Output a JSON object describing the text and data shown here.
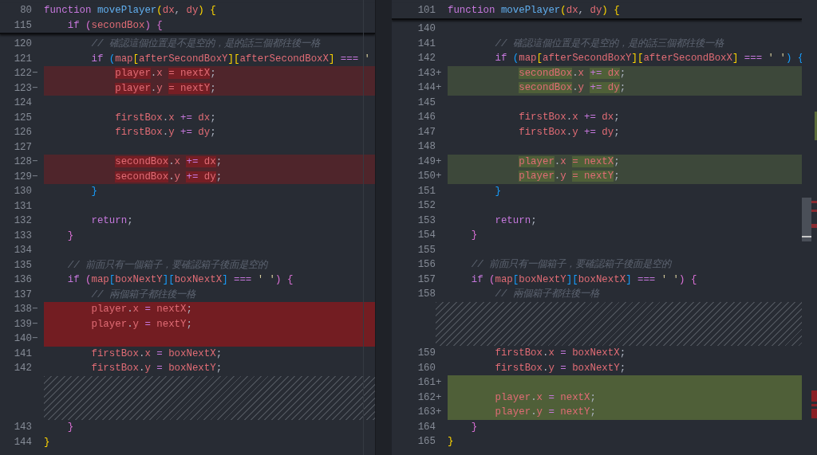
{
  "panes": [
    {
      "sticky": [
        {
          "num": "80",
          "tokens": [
            {
              "text": "function ",
              "kind": "kw"
            },
            {
              "text": "movePlayer",
              "kind": "fn"
            },
            {
              "text": "(",
              "kind": "b1"
            },
            {
              "text": "dx",
              "kind": "var"
            },
            {
              "text": ", ",
              "kind": "punc"
            },
            {
              "text": "dy",
              "kind": "var"
            },
            {
              "text": ")",
              "kind": "b1"
            },
            {
              "text": " {",
              "kind": "b1"
            }
          ]
        },
        {
          "num": "115",
          "tokens": [
            {
              "text": "    if ",
              "kind": "kw"
            },
            {
              "text": "(",
              "kind": "b2"
            },
            {
              "text": "secondBox",
              "kind": "var"
            },
            {
              "text": ")",
              "kind": "b2"
            },
            {
              "text": " {",
              "kind": "b2"
            }
          ]
        }
      ],
      "lines": [
        {
          "kind": "context",
          "num": "120",
          "tokens": [
            {
              "text": "        // 確認這個位置是不是空的，是的話三個都往後一格",
              "kind": "comment"
            }
          ]
        },
        {
          "kind": "context",
          "num": "121",
          "tokens": [
            {
              "text": "        if ",
              "kind": "kw"
            },
            {
              "text": "(",
              "kind": "b3"
            },
            {
              "text": "map",
              "kind": "var"
            },
            {
              "text": "[",
              "kind": "b1"
            },
            {
              "text": "afterSecondBoxY",
              "kind": "var"
            },
            {
              "text": "]",
              "kind": "b1"
            },
            {
              "text": "[",
              "kind": "b1"
            },
            {
              "text": "afterSecondBoxX",
              "kind": "var"
            },
            {
              "text": "]",
              "kind": "b1"
            },
            {
              "text": " === ",
              "kind": "kw"
            },
            {
              "text": "'",
              "kind": "str"
            }
          ]
        },
        {
          "kind": "removed",
          "num": "122",
          "marker": "−",
          "tokens": [
            {
              "text": "            player",
              "kind": "var",
              "hl": true
            },
            {
              "text": ".",
              "kind": "punc",
              "hl": false
            },
            {
              "text": "x ",
              "kind": "var",
              "hl": false
            },
            {
              "text": "= nextX",
              "kind": "var",
              "hl": true
            },
            {
              "text": ";",
              "kind": "punc",
              "hl": false
            }
          ]
        },
        {
          "kind": "removed",
          "num": "123",
          "marker": "−",
          "tokens": [
            {
              "text": "            player",
              "kind": "var",
              "hl": true
            },
            {
              "text": ".",
              "kind": "punc",
              "hl": false
            },
            {
              "text": "y ",
              "kind": "var",
              "hl": false
            },
            {
              "text": "= nextY",
              "kind": "var",
              "hl": true
            },
            {
              "text": ";",
              "kind": "punc",
              "hl": false
            }
          ]
        },
        {
          "kind": "context",
          "num": "124"
        },
        {
          "kind": "context",
          "num": "125",
          "tokens": [
            {
              "text": "            firstBox",
              "kind": "var"
            },
            {
              "text": ".",
              "kind": "punc"
            },
            {
              "text": "x ",
              "kind": "var"
            },
            {
              "text": "+= ",
              "kind": "kw"
            },
            {
              "text": "dx",
              "kind": "var"
            },
            {
              "text": ";",
              "kind": "punc"
            }
          ]
        },
        {
          "kind": "context",
          "num": "126",
          "tokens": [
            {
              "text": "            firstBox",
              "kind": "var"
            },
            {
              "text": ".",
              "kind": "punc"
            },
            {
              "text": "y ",
              "kind": "var"
            },
            {
              "text": "+= ",
              "kind": "kw"
            },
            {
              "text": "dy",
              "kind": "var"
            },
            {
              "text": ";",
              "kind": "punc"
            }
          ]
        },
        {
          "kind": "context",
          "num": "127"
        },
        {
          "kind": "removed",
          "num": "128",
          "marker": "−",
          "tokens": [
            {
              "text": "            secondBox",
              "kind": "var",
              "hl": true
            },
            {
              "text": ".",
              "kind": "punc",
              "hl": false
            },
            {
              "text": "x ",
              "kind": "var",
              "hl": false
            },
            {
              "text": "+= ",
              "kind": "kw",
              "hl": true
            },
            {
              "text": "dx",
              "kind": "var",
              "hl": true
            },
            {
              "text": ";",
              "kind": "punc",
              "hl": false
            }
          ]
        },
        {
          "kind": "removed",
          "num": "129",
          "marker": "−",
          "tokens": [
            {
              "text": "            secondBox",
              "kind": "var",
              "hl": true
            },
            {
              "text": ".",
              "kind": "punc",
              "hl": false
            },
            {
              "text": "y ",
              "kind": "var",
              "hl": false
            },
            {
              "text": "+= ",
              "kind": "kw",
              "hl": true
            },
            {
              "text": "dy",
              "kind": "var",
              "hl": true
            },
            {
              "text": ";",
              "kind": "punc",
              "hl": false
            }
          ]
        },
        {
          "kind": "context",
          "num": "130",
          "tokens": [
            {
              "text": "        }",
              "kind": "b3"
            }
          ]
        },
        {
          "kind": "context",
          "num": "131"
        },
        {
          "kind": "context",
          "num": "132",
          "tokens": [
            {
              "text": "        return",
              "kind": "kw"
            },
            {
              "text": ";",
              "kind": "punc"
            }
          ]
        },
        {
          "kind": "context",
          "num": "133",
          "tokens": [
            {
              "text": "    }",
              "kind": "b2"
            }
          ]
        },
        {
          "kind": "context",
          "num": "134"
        },
        {
          "kind": "context",
          "num": "135",
          "tokens": [
            {
              "text": "    // 前面只有一個箱子，要確認箱子後面是空的",
              "kind": "comment"
            }
          ]
        },
        {
          "kind": "context",
          "num": "136",
          "tokens": [
            {
              "text": "    if ",
              "kind": "kw"
            },
            {
              "text": "(",
              "kind": "b2"
            },
            {
              "text": "map",
              "kind": "var"
            },
            {
              "text": "[",
              "kind": "b3"
            },
            {
              "text": "boxNextY",
              "kind": "var"
            },
            {
              "text": "]",
              "kind": "b3"
            },
            {
              "text": "[",
              "kind": "b3"
            },
            {
              "text": "boxNextX",
              "kind": "var"
            },
            {
              "text": "]",
              "kind": "b3"
            },
            {
              "text": " === ",
              "kind": "kw"
            },
            {
              "text": "' '",
              "kind": "str"
            },
            {
              "text": ")",
              "kind": "b2"
            },
            {
              "text": " {",
              "kind": "b2"
            }
          ]
        },
        {
          "kind": "context",
          "num": "137",
          "tokens": [
            {
              "text": "        // 兩個箱子都往後一格",
              "kind": "comment"
            }
          ]
        },
        {
          "kind": "removed-whole",
          "num": "138",
          "marker": "−",
          "tokens": [
            {
              "text": "        player",
              "kind": "var"
            },
            {
              "text": ".",
              "kind": "punc"
            },
            {
              "text": "x ",
              "kind": "var"
            },
            {
              "text": "= ",
              "kind": "kw"
            },
            {
              "text": "nextX",
              "kind": "var"
            },
            {
              "text": ";",
              "kind": "punc"
            }
          ]
        },
        {
          "kind": "removed-whole",
          "num": "139",
          "marker": "−",
          "tokens": [
            {
              "text": "        player",
              "kind": "var"
            },
            {
              "text": ".",
              "kind": "punc"
            },
            {
              "text": "y ",
              "kind": "var"
            },
            {
              "text": "= ",
              "kind": "kw"
            },
            {
              "text": "nextY",
              "kind": "var"
            },
            {
              "text": ";",
              "kind": "punc"
            }
          ]
        },
        {
          "kind": "removed-whole",
          "num": "140",
          "marker": "−"
        },
        {
          "kind": "context",
          "num": "141",
          "tokens": [
            {
              "text": "        firstBox",
              "kind": "var"
            },
            {
              "text": ".",
              "kind": "punc"
            },
            {
              "text": "x ",
              "kind": "var"
            },
            {
              "text": "= ",
              "kind": "kw"
            },
            {
              "text": "boxNextX",
              "kind": "var"
            },
            {
              "text": ";",
              "kind": "punc"
            }
          ]
        },
        {
          "kind": "context",
          "num": "142",
          "tokens": [
            {
              "text": "        firstBox",
              "kind": "var"
            },
            {
              "text": ".",
              "kind": "punc"
            },
            {
              "text": "y ",
              "kind": "var"
            },
            {
              "text": "= ",
              "kind": "kw"
            },
            {
              "text": "boxNextY",
              "kind": "var"
            },
            {
              "text": ";",
              "kind": "punc"
            }
          ]
        },
        {
          "kind": "filler"
        },
        {
          "kind": "context",
          "num": "143",
          "tokens": [
            {
              "text": "    }",
              "kind": "b2"
            }
          ]
        },
        {
          "kind": "context",
          "num": "144",
          "tokens": [
            {
              "text": "}",
              "kind": "b1"
            }
          ]
        }
      ]
    },
    {
      "sticky": [
        {
          "num": "101",
          "tokens": [
            {
              "text": "function ",
              "kind": "kw"
            },
            {
              "text": "movePlayer",
              "kind": "fn"
            },
            {
              "text": "(",
              "kind": "b1"
            },
            {
              "text": "dx",
              "kind": "var"
            },
            {
              "text": ", ",
              "kind": "punc"
            },
            {
              "text": "dy",
              "kind": "var"
            },
            {
              "text": ")",
              "kind": "b1"
            },
            {
              "text": " {",
              "kind": "b1"
            }
          ]
        }
      ],
      "lines": [
        {
          "kind": "context",
          "num": "140"
        },
        {
          "kind": "context",
          "num": "141",
          "tokens": [
            {
              "text": "        // 確認這個位置是不是空的，是的話三個都往後一格",
              "kind": "comment"
            }
          ]
        },
        {
          "kind": "context",
          "num": "142",
          "tokens": [
            {
              "text": "        if ",
              "kind": "kw"
            },
            {
              "text": "(",
              "kind": "b3"
            },
            {
              "text": "map",
              "kind": "var"
            },
            {
              "text": "[",
              "kind": "b1"
            },
            {
              "text": "afterSecondBoxY",
              "kind": "var"
            },
            {
              "text": "]",
              "kind": "b1"
            },
            {
              "text": "[",
              "kind": "b1"
            },
            {
              "text": "afterSecondBoxX",
              "kind": "var"
            },
            {
              "text": "]",
              "kind": "b1"
            },
            {
              "text": " === ",
              "kind": "kw"
            },
            {
              "text": "' '",
              "kind": "str"
            },
            {
              "text": ")",
              "kind": "b3"
            },
            {
              "text": " {",
              "kind": "b3"
            }
          ]
        },
        {
          "kind": "added",
          "num": "143",
          "marker": "+",
          "tokens": [
            {
              "text": "            secondBox",
              "kind": "var",
              "hl": true
            },
            {
              "text": ".",
              "kind": "punc",
              "hl": false
            },
            {
              "text": "x ",
              "kind": "var",
              "hl": false
            },
            {
              "text": "+= ",
              "kind": "kw",
              "hl": true
            },
            {
              "text": "dx",
              "kind": "var",
              "hl": true
            },
            {
              "text": ";",
              "kind": "punc",
              "hl": false
            }
          ]
        },
        {
          "kind": "added",
          "num": "144",
          "marker": "+",
          "tokens": [
            {
              "text": "            secondBox",
              "kind": "var",
              "hl": true
            },
            {
              "text": ".",
              "kind": "punc",
              "hl": false
            },
            {
              "text": "y ",
              "kind": "var",
              "hl": false
            },
            {
              "text": "+= ",
              "kind": "kw",
              "hl": true
            },
            {
              "text": "dy",
              "kind": "var",
              "hl": true
            },
            {
              "text": ";",
              "kind": "punc",
              "hl": false
            }
          ]
        },
        {
          "kind": "context",
          "num": "145"
        },
        {
          "kind": "context",
          "num": "146",
          "tokens": [
            {
              "text": "            firstBox",
              "kind": "var"
            },
            {
              "text": ".",
              "kind": "punc"
            },
            {
              "text": "x ",
              "kind": "var"
            },
            {
              "text": "+= ",
              "kind": "kw"
            },
            {
              "text": "dx",
              "kind": "var"
            },
            {
              "text": ";",
              "kind": "punc"
            }
          ]
        },
        {
          "kind": "context",
          "num": "147",
          "tokens": [
            {
              "text": "            firstBox",
              "kind": "var"
            },
            {
              "text": ".",
              "kind": "punc"
            },
            {
              "text": "y ",
              "kind": "var"
            },
            {
              "text": "+= ",
              "kind": "kw"
            },
            {
              "text": "dy",
              "kind": "var"
            },
            {
              "text": ";",
              "kind": "punc"
            }
          ]
        },
        {
          "kind": "context",
          "num": "148"
        },
        {
          "kind": "added",
          "num": "149",
          "marker": "+",
          "tokens": [
            {
              "text": "            player",
              "kind": "var",
              "hl": true
            },
            {
              "text": ".",
              "kind": "punc",
              "hl": false
            },
            {
              "text": "x ",
              "kind": "var",
              "hl": false
            },
            {
              "text": "= nextX",
              "kind": "var",
              "hl": true
            },
            {
              "text": ";",
              "kind": "punc",
              "hl": false
            }
          ]
        },
        {
          "kind": "added",
          "num": "150",
          "marker": "+",
          "tokens": [
            {
              "text": "            player",
              "kind": "var",
              "hl": true
            },
            {
              "text": ".",
              "kind": "punc",
              "hl": false
            },
            {
              "text": "y ",
              "kind": "var",
              "hl": false
            },
            {
              "text": "= nextY",
              "kind": "var",
              "hl": true
            },
            {
              "text": ";",
              "kind": "punc",
              "hl": false
            }
          ]
        },
        {
          "kind": "context",
          "num": "151",
          "tokens": [
            {
              "text": "        }",
              "kind": "b3"
            }
          ]
        },
        {
          "kind": "context",
          "num": "152"
        },
        {
          "kind": "context",
          "num": "153",
          "tokens": [
            {
              "text": "        return",
              "kind": "kw"
            },
            {
              "text": ";",
              "kind": "punc"
            }
          ]
        },
        {
          "kind": "context",
          "num": "154",
          "tokens": [
            {
              "text": "    }",
              "kind": "b2"
            }
          ]
        },
        {
          "kind": "context",
          "num": "155"
        },
        {
          "kind": "context",
          "num": "156",
          "tokens": [
            {
              "text": "    // 前面只有一個箱子，要確認箱子後面是空的",
              "kind": "comment"
            }
          ]
        },
        {
          "kind": "context",
          "num": "157",
          "tokens": [
            {
              "text": "    if ",
              "kind": "kw"
            },
            {
              "text": "(",
              "kind": "b2"
            },
            {
              "text": "map",
              "kind": "var"
            },
            {
              "text": "[",
              "kind": "b3"
            },
            {
              "text": "boxNextY",
              "kind": "var"
            },
            {
              "text": "]",
              "kind": "b3"
            },
            {
              "text": "[",
              "kind": "b3"
            },
            {
              "text": "boxNextX",
              "kind": "var"
            },
            {
              "text": "]",
              "kind": "b3"
            },
            {
              "text": " === ",
              "kind": "kw"
            },
            {
              "text": "' '",
              "kind": "str"
            },
            {
              "text": ")",
              "kind": "b2"
            },
            {
              "text": " {",
              "kind": "b2"
            }
          ]
        },
        {
          "kind": "context",
          "num": "158",
          "tokens": [
            {
              "text": "        // 兩個箱子都往後一格",
              "kind": "comment"
            }
          ]
        },
        {
          "kind": "filler"
        },
        {
          "kind": "context",
          "num": "159",
          "tokens": [
            {
              "text": "        firstBox",
              "kind": "var"
            },
            {
              "text": ".",
              "kind": "punc"
            },
            {
              "text": "x ",
              "kind": "var"
            },
            {
              "text": "= ",
              "kind": "kw"
            },
            {
              "text": "boxNextX",
              "kind": "var"
            },
            {
              "text": ";",
              "kind": "punc"
            }
          ]
        },
        {
          "kind": "context",
          "num": "160",
          "tokens": [
            {
              "text": "        firstBox",
              "kind": "var"
            },
            {
              "text": ".",
              "kind": "punc"
            },
            {
              "text": "y ",
              "kind": "var"
            },
            {
              "text": "= ",
              "kind": "kw"
            },
            {
              "text": "boxNextY",
              "kind": "var"
            },
            {
              "text": ";",
              "kind": "punc"
            }
          ]
        },
        {
          "kind": "added-whole",
          "num": "161",
          "marker": "+"
        },
        {
          "kind": "added-whole",
          "num": "162",
          "marker": "+",
          "tokens": [
            {
              "text": "        player",
              "kind": "var"
            },
            {
              "text": ".",
              "kind": "punc"
            },
            {
              "text": "x ",
              "kind": "var"
            },
            {
              "text": "= ",
              "kind": "kw"
            },
            {
              "text": "nextX",
              "kind": "var"
            },
            {
              "text": ";",
              "kind": "punc"
            }
          ]
        },
        {
          "kind": "added-whole",
          "num": "163",
          "marker": "+",
          "tokens": [
            {
              "text": "        player",
              "kind": "var"
            },
            {
              "text": ".",
              "kind": "punc"
            },
            {
              "text": "y ",
              "kind": "var"
            },
            {
              "text": "= ",
              "kind": "kw"
            },
            {
              "text": "nextY",
              "kind": "var"
            },
            {
              "text": ";",
              "kind": "punc"
            }
          ]
        },
        {
          "kind": "context",
          "num": "164",
          "tokens": [
            {
              "text": "    }",
              "kind": "b2"
            }
          ]
        },
        {
          "kind": "context",
          "num": "165",
          "tokens": [
            {
              "text": "}",
              "kind": "b1"
            }
          ]
        }
      ]
    }
  ]
}
